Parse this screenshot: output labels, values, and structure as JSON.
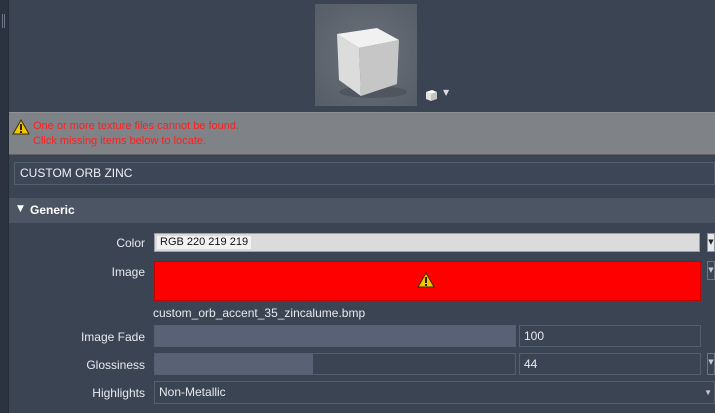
{
  "warning": {
    "line1": "One or more texture files cannot be found.",
    "line2": "Click missing items below to locate."
  },
  "material": {
    "name": "CUSTOM ORB ZINC"
  },
  "section": {
    "title": "Generic",
    "arrow": "▼"
  },
  "properties": {
    "color": {
      "label": "Color",
      "value": "RGB 220 219 219",
      "swatch": "#dcdbdb"
    },
    "image": {
      "label": "Image",
      "filename": "custom_orb_accent_35_zincalume.bmp",
      "status_color": "#ff0000"
    },
    "image_fade": {
      "label": "Image Fade",
      "value": "100",
      "fraction": 1.0
    },
    "glossiness": {
      "label": "Glossiness",
      "value": "44",
      "fraction": 0.44
    },
    "highlights": {
      "label": "Highlights",
      "value": "Non-Metallic"
    }
  },
  "icons": {
    "preview": "cube-preview",
    "shape": "cube-icon",
    "warning": "warning-triangle-icon"
  }
}
